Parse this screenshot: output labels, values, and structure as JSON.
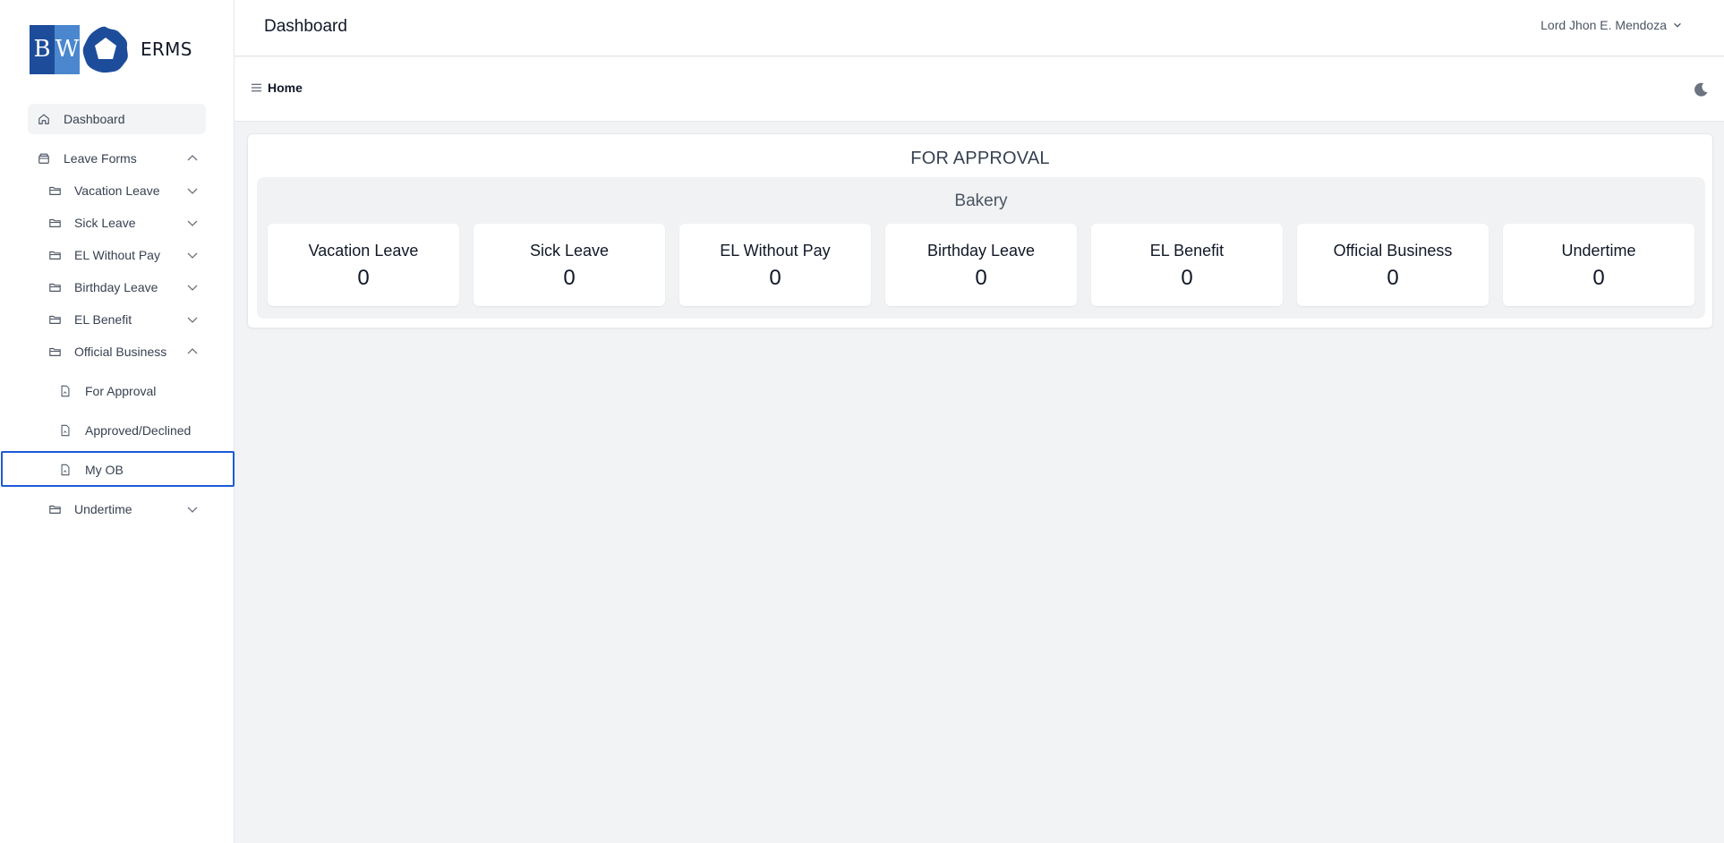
{
  "brand": {
    "logo_text_b": "B",
    "logo_text_w": "W",
    "name": "ERMS"
  },
  "header": {
    "title": "Dashboard",
    "user_name": "Lord Jhon E. Mendoza"
  },
  "breadcrumb": {
    "current": "Home"
  },
  "sidebar": {
    "items": [
      {
        "label": "Dashboard"
      },
      {
        "label": "Leave Forms"
      },
      {
        "label": "Vacation Leave"
      },
      {
        "label": "Sick Leave"
      },
      {
        "label": "EL Without Pay"
      },
      {
        "label": "Birthday Leave"
      },
      {
        "label": "EL Benefit"
      },
      {
        "label": "Official Business"
      },
      {
        "label": "For Approval"
      },
      {
        "label": "Approved/Declined"
      },
      {
        "label": "My OB"
      },
      {
        "label": "Undertime"
      }
    ]
  },
  "main": {
    "section_title": "FOR APPROVAL",
    "department": "Bakery",
    "cards": [
      {
        "label": "Vacation Leave",
        "value": "0"
      },
      {
        "label": "Sick Leave",
        "value": "0"
      },
      {
        "label": "EL Without Pay",
        "value": "0"
      },
      {
        "label": "Birthday Leave",
        "value": "0"
      },
      {
        "label": "EL Benefit",
        "value": "0"
      },
      {
        "label": "Official Business",
        "value": "0"
      },
      {
        "label": "Undertime",
        "value": "0"
      }
    ]
  },
  "colors": {
    "accent": "#1d5ad6",
    "brand_dark": "#1d4d9a",
    "brand_light": "#4a87cf"
  }
}
